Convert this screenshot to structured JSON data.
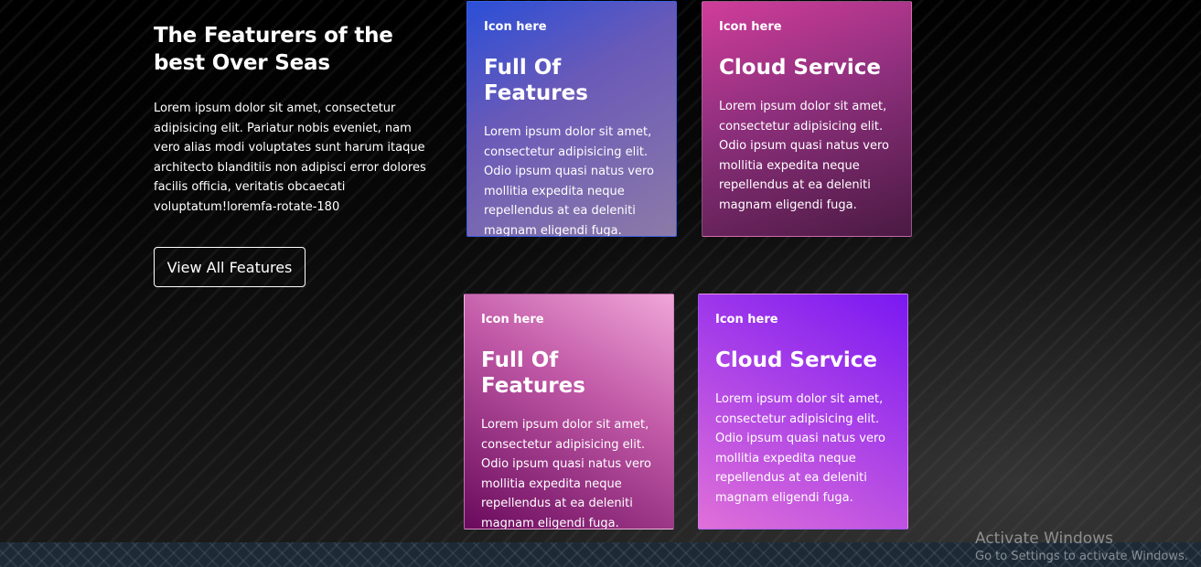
{
  "intro": {
    "title": "The Featurers of the best Over Seas",
    "text": "Lorem ipsum dolor sit amet, consectetur adipisicing elit. Pariatur nobis eveniet, nam vero alias modi voluptates sunt harum itaque architecto blanditiis non adipisci error dolores facilis officia, veritatis obcaecati voluptatum!loremfa-rotate-180",
    "button_label": "View All Features"
  },
  "cards": [
    {
      "icon_label": "Icon here",
      "title": "Full Of Features",
      "text": "Lorem ipsum dolor sit amet, consectetur adipisicing elit. Odio ipsum quasi natus vero mollitia expedita neque repellendus at ea deleniti magnam eligendi fuga."
    },
    {
      "icon_label": "Icon here",
      "title": "Cloud Service",
      "text": "Lorem ipsum dolor sit amet, consectetur adipisicing elit. Odio ipsum quasi natus vero mollitia expedita neque repellendus at ea deleniti magnam eligendi fuga."
    },
    {
      "icon_label": "Icon here",
      "title": "Full Of Features",
      "text": "Lorem ipsum dolor sit amet, consectetur adipisicing elit. Odio ipsum quasi natus vero mollitia expedita neque repellendus at ea deleniti magnam eligendi fuga."
    },
    {
      "icon_label": "Icon here",
      "title": "Cloud Service",
      "text": "Lorem ipsum dolor sit amet, consectetur adipisicing elit. Odio ipsum quasi natus vero mollitia expedita neque repellendus at ea deleniti magnam eligendi fuga."
    }
  ],
  "watermark": {
    "title": "Activate Windows",
    "subtitle": "Go to Settings to activate Windows."
  },
  "colors": {
    "background": "#0c0c0c",
    "text": "#ffffff",
    "card_1": "#6a5ab8",
    "card_2": "#8d2f7c",
    "card_3": "#c25aa8",
    "card_4": "#a840e8"
  }
}
